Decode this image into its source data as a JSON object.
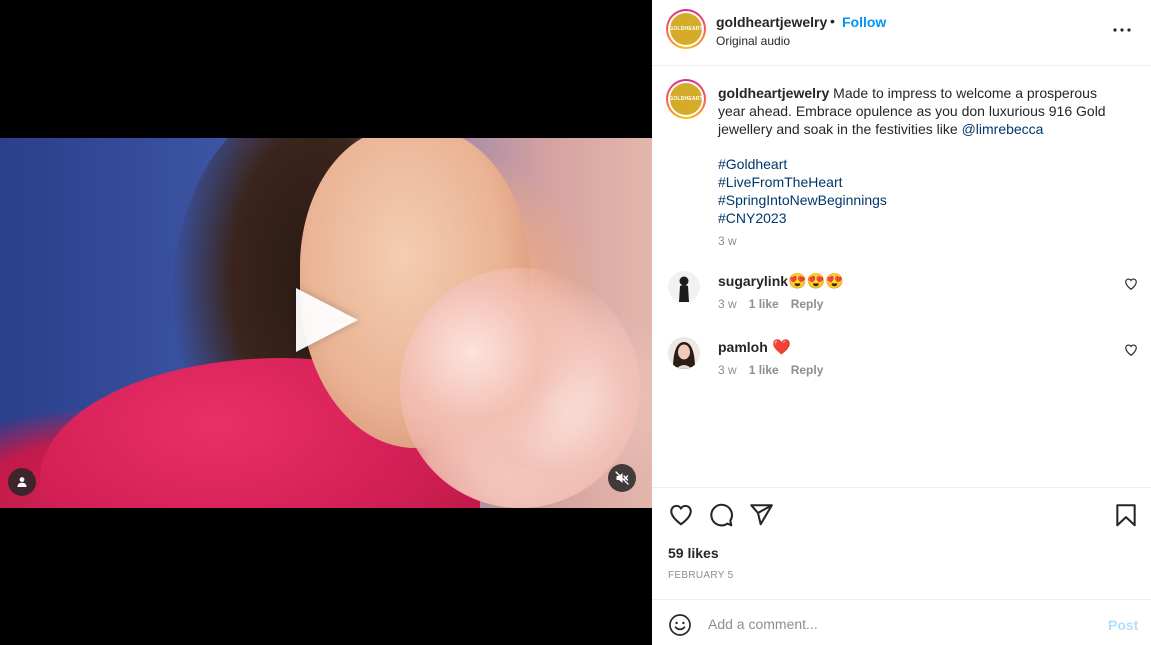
{
  "post": {
    "username": "goldheartjewelry",
    "separator": "•",
    "follow_label": "Follow",
    "audio": "Original audio",
    "avatar_text": "GOLDHEART"
  },
  "caption": {
    "username": "goldheartjewelry",
    "text_before_mention": " Made to impress to welcome a prosperous year ahead. Embrace opulence as you don luxurious 916 Gold jewellery and soak in the festivities like ",
    "mention": "@limrebecca",
    "hashtags": [
      "#Goldheart",
      "#LiveFromTheHeart",
      "#SpringIntoNewBeginnings",
      "#CNY2023"
    ],
    "time": "3 w"
  },
  "comments": [
    {
      "username": "sugarylink",
      "text": "😍😍😍",
      "time": "3 w",
      "likes": "1 like",
      "reply_label": "Reply"
    },
    {
      "username": "pamloh",
      "text": "❤️",
      "time": "3 w",
      "likes": "1 like",
      "reply_label": "Reply"
    }
  ],
  "engagement": {
    "likes": "59 likes",
    "date": "FEBRUARY 5"
  },
  "composer": {
    "placeholder": "Add a comment...",
    "post_label": "Post"
  },
  "icons": {
    "header_more": "more-options-icon",
    "like": "heart-icon",
    "comment": "comment-icon",
    "share": "share-icon",
    "save": "bookmark-icon",
    "emoji": "emoji-icon",
    "play": "play-icon",
    "tagged_user": "user-icon",
    "mute": "muted-speaker-icon"
  },
  "colors": {
    "link": "#00376b",
    "follow": "#0095f6",
    "brand_gold": "#d4ac2a",
    "muted_text": "#8e8e8e",
    "heart_red": "#e0245e"
  }
}
